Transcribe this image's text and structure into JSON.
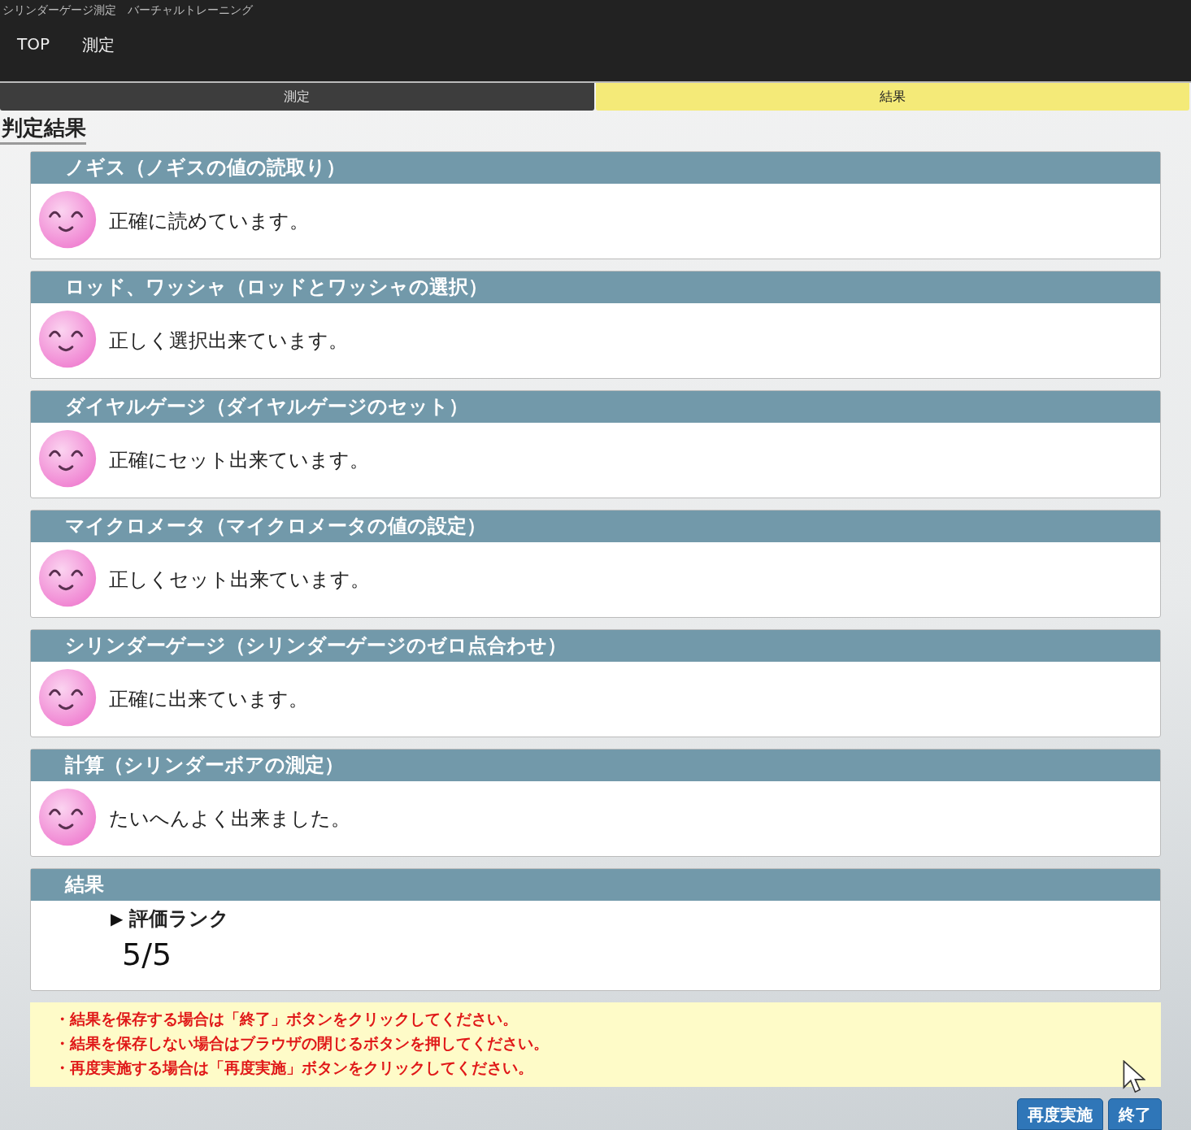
{
  "window": {
    "title": "シリンダーゲージ測定　バーチャルトレーニング"
  },
  "nav": [
    {
      "label": "TOP"
    },
    {
      "label": "測定"
    }
  ],
  "tabs": [
    {
      "label": "測定",
      "selected": false
    },
    {
      "label": "結果",
      "selected": true
    }
  ],
  "heading": "判定結果",
  "sections": [
    {
      "title": "ノギス（ノギスの値の読取り）",
      "message": "正確に読めています。"
    },
    {
      "title": "ロッド、ワッシャ（ロッドとワッシャの選択）",
      "message": "正しく選択出来ています。"
    },
    {
      "title": "ダイヤルゲージ（ダイヤルゲージのセット）",
      "message": "正確にセット出来ています。"
    },
    {
      "title": "マイクロメータ（マイクロメータの値の設定）",
      "message": "正しくセット出来ています。"
    },
    {
      "title": "シリンダーゲージ（シリンダーゲージのゼロ点合わせ）",
      "message": "正確に出来ています。"
    },
    {
      "title": "計算（シリンダーボアの測定）",
      "message": "たいへんよく出来ました。"
    }
  ],
  "result": {
    "title": "結果",
    "marker": "▶",
    "label": "評価ランク",
    "rank": "5/5"
  },
  "notes": [
    "・結果を保存する場合は「終了」ボタンをクリックしてください。",
    "・結果を保存しない場合はブラウザの閉じるボタンを押してください。",
    "・再度実施する場合は「再度実施」ボタンをクリックしてください。"
  ],
  "buttons": [
    {
      "label": "再度実施"
    },
    {
      "label": "終了"
    }
  ]
}
